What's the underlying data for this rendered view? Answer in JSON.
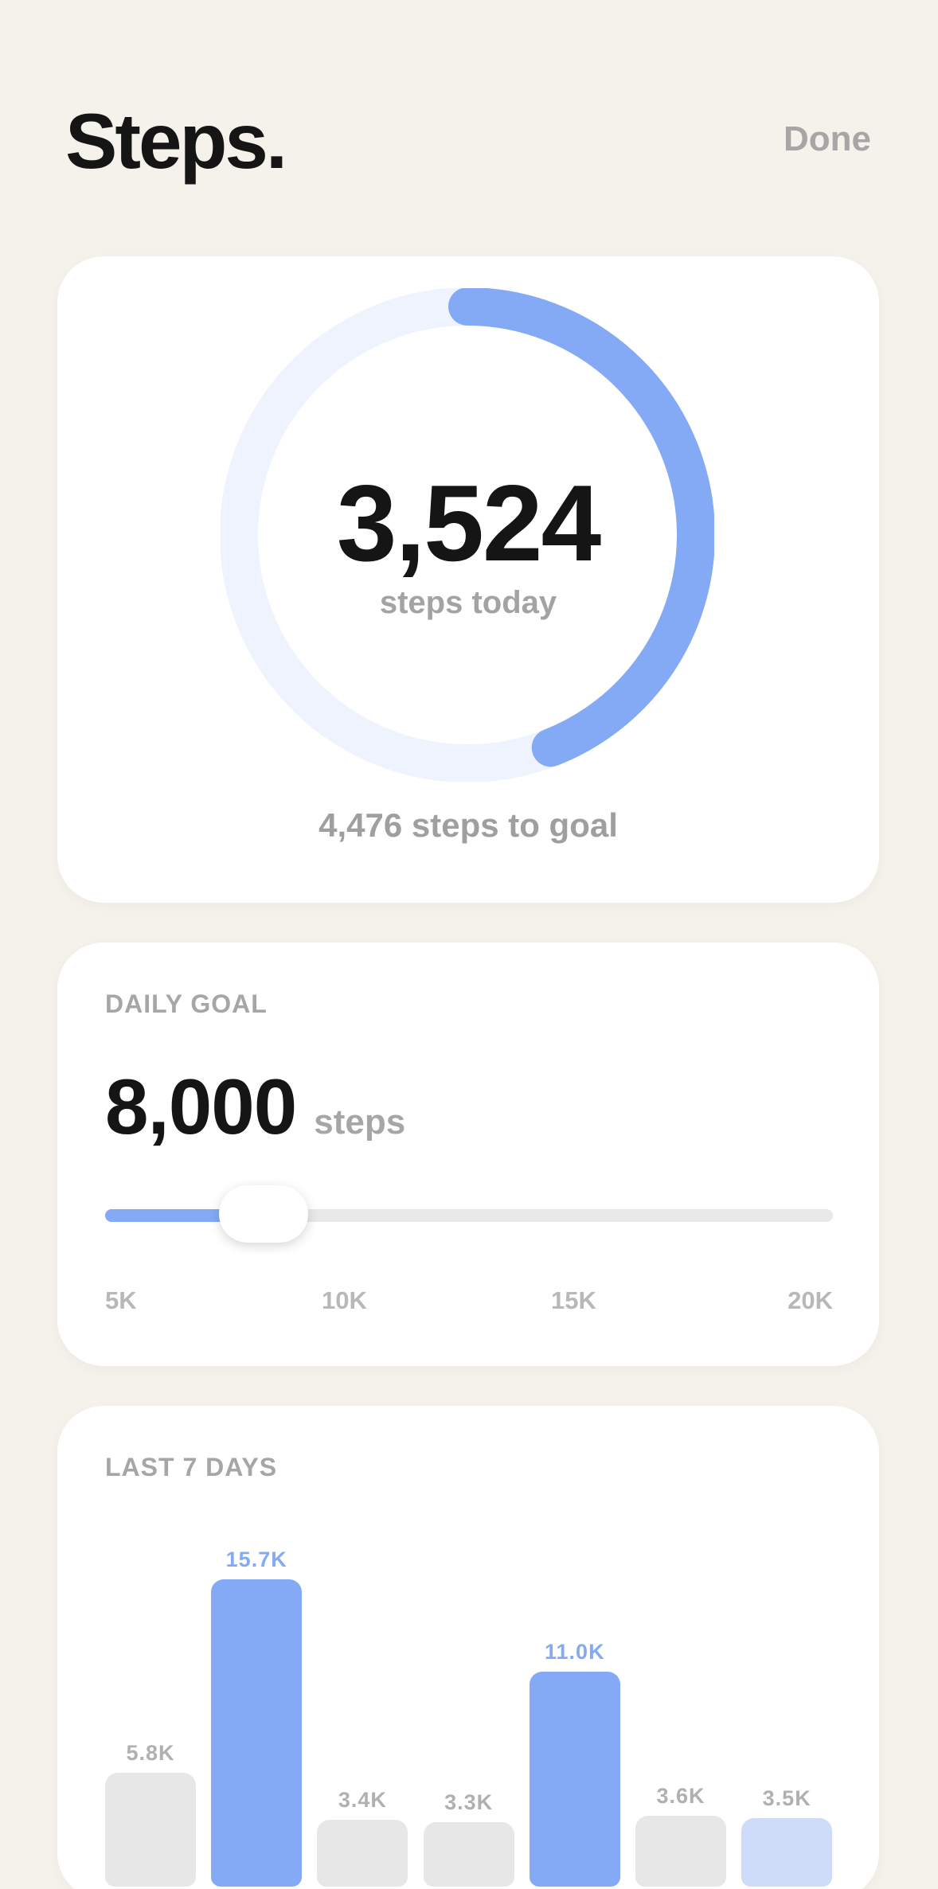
{
  "header": {
    "title": "Steps.",
    "done_label": "Done"
  },
  "today": {
    "steps": "3,524",
    "steps_label": "steps today",
    "remaining": "4,476 steps to goal",
    "progress_fraction": 0.4405
  },
  "goal": {
    "section_label": "DAILY GOAL",
    "value": "8,000",
    "unit": "steps",
    "slider_min": 5000,
    "slider_max": 20000,
    "slider_value": 8000,
    "scale": [
      "5K",
      "10K",
      "15K",
      "20K"
    ]
  },
  "colors": {
    "accent": "#84aaf5",
    "accent_light": "#cfdcf9",
    "ring_track": "#eef3fd",
    "neutral_bar": "#e7e7e7",
    "muted_text": "#a6a6a6",
    "background": "#f5f1eb"
  },
  "history": {
    "section_label": "LAST 7 DAYS"
  },
  "chart_data": {
    "type": "bar",
    "title": "LAST 7 DAYS",
    "values": [
      5800,
      15700,
      3400,
      3300,
      11000,
      3600,
      3500
    ],
    "labels": [
      "5.8K",
      "15.7K",
      "3.4K",
      "3.3K",
      "11.0K",
      "3.6K",
      "3.5K"
    ],
    "status": [
      "below",
      "met",
      "below",
      "below",
      "met",
      "below",
      "today"
    ],
    "goal": 8000
  }
}
